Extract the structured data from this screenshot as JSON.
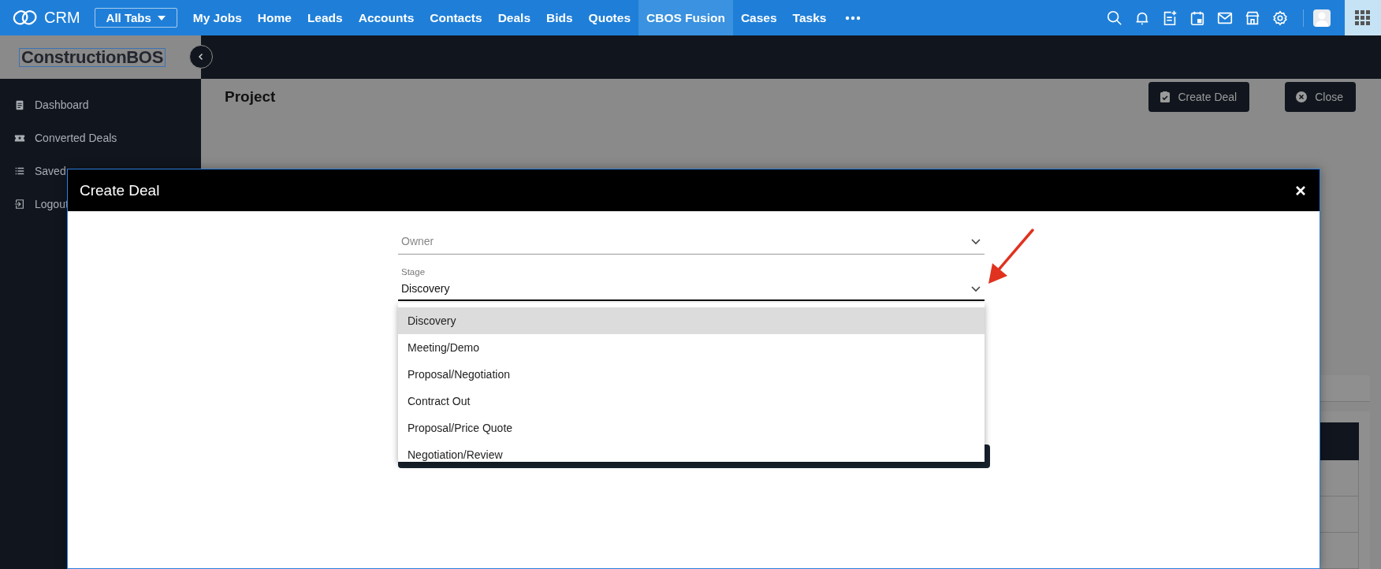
{
  "top_nav": {
    "brand": "CRM",
    "all_tabs": "All Tabs",
    "tabs": [
      {
        "label": "My Jobs",
        "selected": false
      },
      {
        "label": "Home",
        "selected": false
      },
      {
        "label": "Leads",
        "selected": false
      },
      {
        "label": "Accounts",
        "selected": false
      },
      {
        "label": "Contacts",
        "selected": false
      },
      {
        "label": "Deals",
        "selected": false
      },
      {
        "label": "Bids",
        "selected": false
      },
      {
        "label": "Quotes",
        "selected": false
      },
      {
        "label": "CBOS Fusion",
        "selected": true
      },
      {
        "label": "Cases",
        "selected": false
      },
      {
        "label": "Tasks",
        "selected": false
      }
    ]
  },
  "sidebar": {
    "logo": "ConstructionBOS",
    "items": [
      "Dashboard",
      "Converted Deals",
      "Saved",
      "Logout"
    ]
  },
  "page": {
    "title": "Project",
    "buttons": [
      "Create Deal",
      "Close"
    ]
  },
  "dialog": {
    "title": "Create Deal",
    "owner": {
      "placeholder": "Owner"
    },
    "stage": {
      "label": "Stage",
      "value": "Discovery"
    },
    "options": [
      {
        "label": "Discovery",
        "selected": true
      },
      {
        "label": "Meeting/Demo",
        "selected": false
      },
      {
        "label": "Proposal/Negotiation",
        "selected": false
      },
      {
        "label": "Contract Out",
        "selected": false
      },
      {
        "label": "Proposal/Price Quote",
        "selected": false
      },
      {
        "label": "Negotiation/Review",
        "selected": false
      }
    ]
  }
}
